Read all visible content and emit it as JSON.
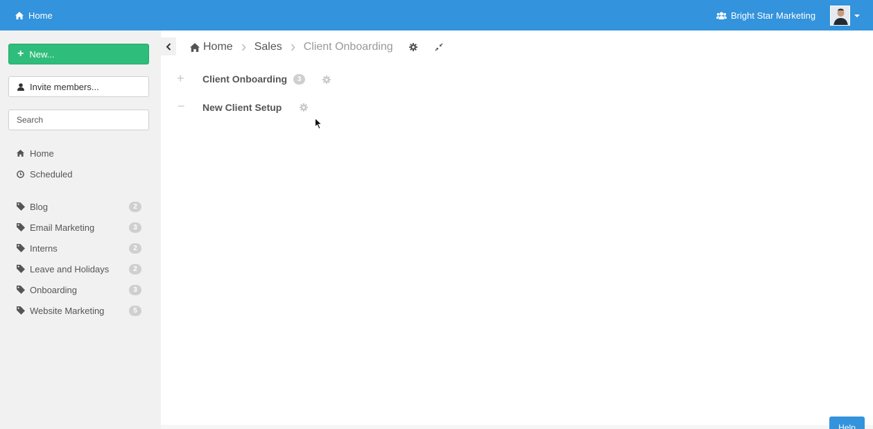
{
  "topbar": {
    "home_label": "Home",
    "org_name": "Bright Star Marketing",
    "accent_color": "#3393dc"
  },
  "sidebar": {
    "new_button": "New...",
    "invite_button": "Invite members...",
    "search_placeholder": "Search",
    "nav": [
      {
        "label": "Home",
        "icon": "home-icon"
      },
      {
        "label": "Scheduled",
        "icon": "clock-icon"
      }
    ],
    "tags": [
      {
        "label": "Blog",
        "count": "2"
      },
      {
        "label": "Email Marketing",
        "count": "3"
      },
      {
        "label": "Interns",
        "count": "2"
      },
      {
        "label": "Leave and Holidays",
        "count": "2"
      },
      {
        "label": "Onboarding",
        "count": "3"
      },
      {
        "label": "Website Marketing",
        "count": "5"
      }
    ]
  },
  "breadcrumb": {
    "items": [
      "Home",
      "Sales",
      "Client Onboarding"
    ]
  },
  "content": {
    "rows": [
      {
        "toggle": "+",
        "title": "Client Onboarding",
        "count": "3"
      },
      {
        "toggle": "−",
        "title": "New Client Setup"
      }
    ]
  },
  "help_label": "Help",
  "colors": {
    "new_button": "#2ebd7b",
    "sidebar_bg": "#f1f1f1",
    "badge": "#cfcfcf"
  }
}
